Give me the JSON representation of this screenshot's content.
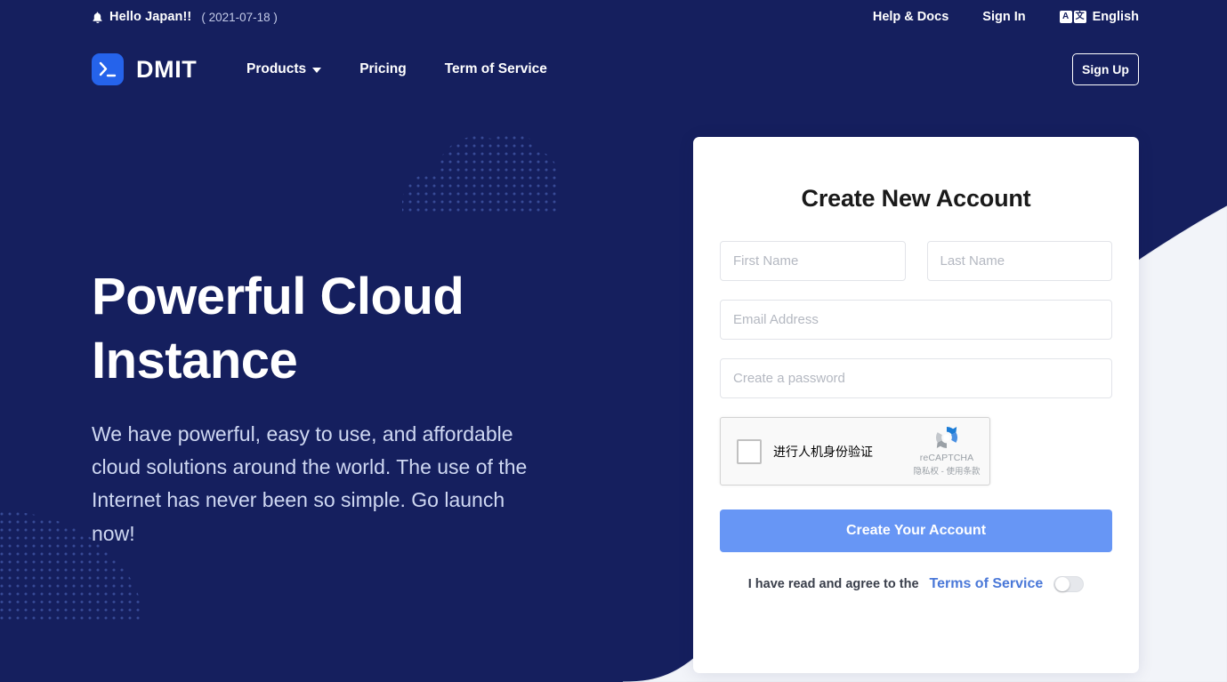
{
  "topbar": {
    "bell_icon": "bell-icon",
    "announcement": "Hello Japan!!",
    "announcement_date": "( 2021-07-18 )",
    "help_docs": "Help & Docs",
    "sign_in": "Sign In",
    "language": "English",
    "lang_icon_a": "A",
    "lang_icon_cjk": "文"
  },
  "nav": {
    "logo_glyph": ">_",
    "brand": "DMIT",
    "items": [
      {
        "label": "Products",
        "has_chevron": true
      },
      {
        "label": "Pricing",
        "has_chevron": false
      },
      {
        "label": "Term of Service",
        "has_chevron": false
      }
    ],
    "sign_up": "Sign Up"
  },
  "hero": {
    "title": "Powerful Cloud Instance",
    "subtitle": "We have powerful, easy to use, and affordable cloud solutions around the world. The use of the Internet has never been so simple. Go launch now!"
  },
  "signup_card": {
    "title": "Create New Account",
    "first_name_placeholder": "First Name",
    "last_name_placeholder": "Last Name",
    "email_placeholder": "Email Address",
    "password_placeholder": "Create a password",
    "first_name_value": "",
    "last_name_value": "",
    "email_value": "",
    "password_value": "",
    "recaptcha": {
      "label": "进行人机身份验证",
      "brand": "reCAPTCHA",
      "terms": "隐私权 - 使用条款",
      "checked": false
    },
    "submit_label": "Create Your Account",
    "agree_text": "I have read and agree to the",
    "agree_link": "Terms of Service",
    "agree_toggle_on": false
  },
  "colors": {
    "background_navy": "#151f5e",
    "panel_light": "#f2f4f9",
    "logo_blue": "#2563eb",
    "primary_button": "#6796f5",
    "link_blue": "#4a78d8",
    "hero_subtitle": "#cfd8f2"
  }
}
